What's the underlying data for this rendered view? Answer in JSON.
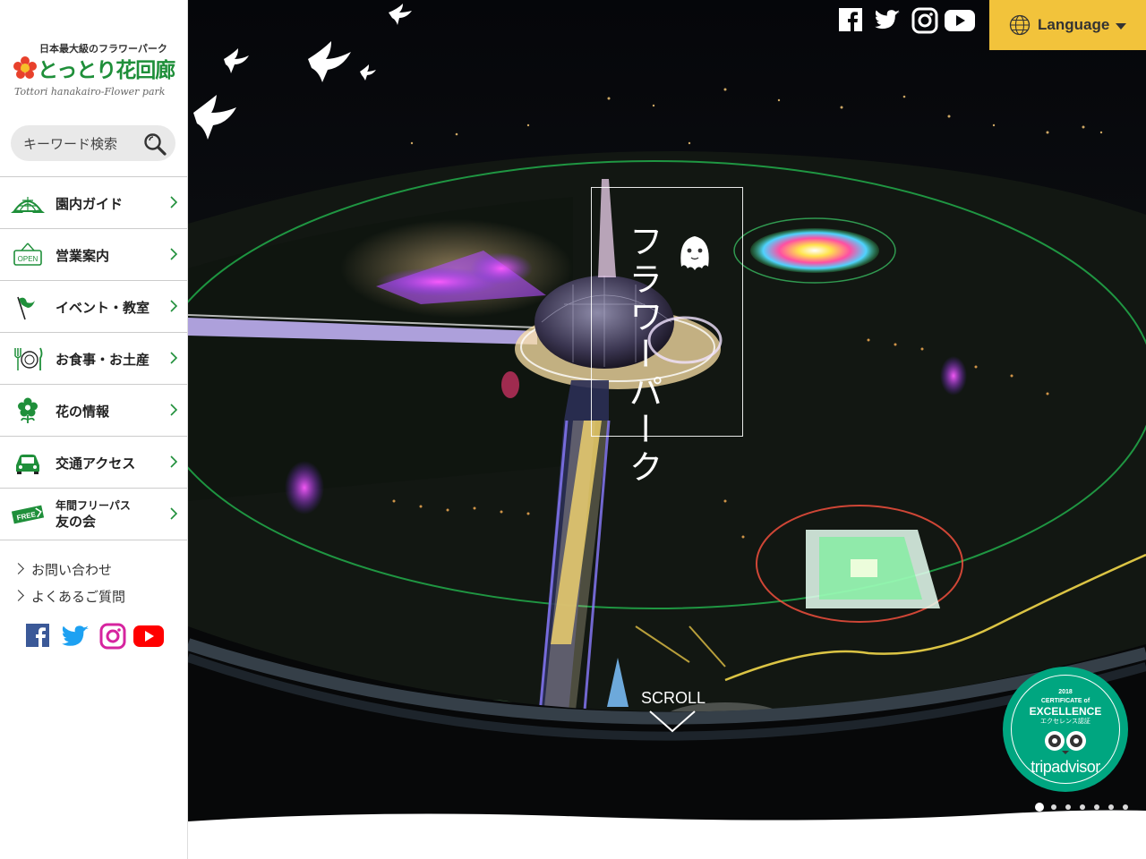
{
  "site": {
    "tagline": "日本最大級のフラワーパーク",
    "name": "とっとり花回廊",
    "roman": "Tottori hanakairo-Flower park",
    "search_placeholder": "キーワード検索"
  },
  "nav": [
    {
      "label": "園内ガイド",
      "icon": "dome-icon"
    },
    {
      "label": "営業案内",
      "icon": "open-sign-icon"
    },
    {
      "label": "イベント・教室",
      "icon": "flag-icon"
    },
    {
      "label": "お食事・お土産",
      "icon": "dining-icon"
    },
    {
      "label": "花の情報",
      "icon": "flower-icon"
    },
    {
      "label": "交通アクセス",
      "icon": "car-icon"
    },
    {
      "label_sub": "年間フリーパス",
      "label": "友の会",
      "icon": "free-pass-icon"
    }
  ],
  "sublinks": [
    "お問い合わせ",
    "よくあるご質問"
  ],
  "social": [
    "facebook-icon",
    "twitter-icon",
    "instagram-icon",
    "youtube-icon"
  ],
  "hero": {
    "vertical_title": "フラワーパーク",
    "scroll_label": "SCROLL",
    "language_label": "Language",
    "slide_count": 7,
    "active_slide": 1
  },
  "badge": {
    "year": "2018",
    "line1": "CERTIFICATE of",
    "line2": "EXCELLENCE",
    "line3": "エクセレンス認証",
    "brand": "tripadvisor"
  },
  "colors": {
    "brand_green": "#1f8f3a",
    "language_bg": "#f2c33b",
    "tripadvisor_green": "#00a680"
  }
}
